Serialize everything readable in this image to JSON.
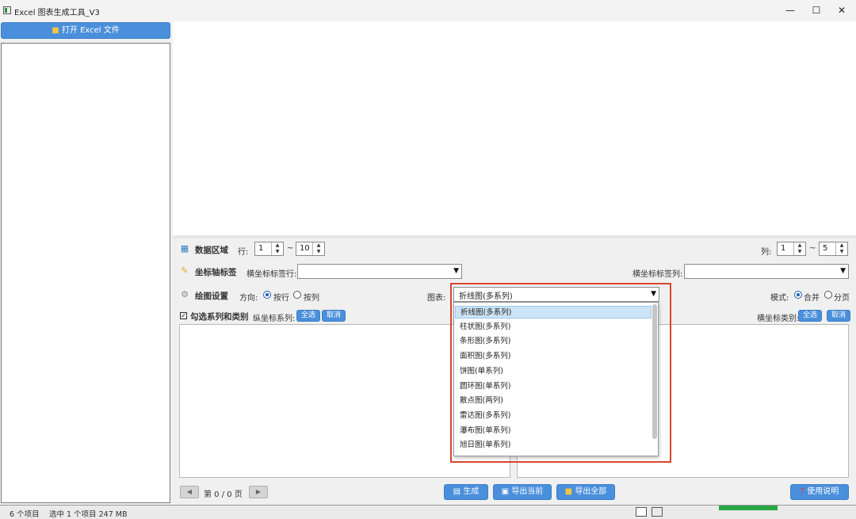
{
  "window": {
    "title": "Excel 图表生成工具_V3"
  },
  "controls": {
    "minimize": "—",
    "maximize": "☐",
    "close": "✕"
  },
  "left": {
    "open_label": "打开 Excel 文件"
  },
  "data_area": {
    "title": "数据区域",
    "row_label": "行:",
    "row_from": "1",
    "row_to": "10",
    "tilde": "~",
    "col_label": "列:",
    "col_from": "1",
    "col_to": "5"
  },
  "axis_labels": {
    "title": "坐标轴标签",
    "x_row_label": "横坐标标签行:",
    "x_row_value": "",
    "x_col_label": "横坐标标签列:",
    "x_col_value": ""
  },
  "plot_settings": {
    "title": "绘图设置",
    "direction_label": "方向:",
    "by_row": "按行",
    "by_col": "按列",
    "chart_label": "图表:",
    "chart_value": "折线图(多系列)",
    "mode_label": "模式:",
    "merge": "合并",
    "split": "分页"
  },
  "series_select": {
    "title": "勾选系列和类别",
    "y_series_label": "纵坐标系列:",
    "select_all": "全选",
    "cancel": "取消",
    "x_category_label": "横坐标类别:"
  },
  "chart_options": [
    "折线图(多系列)",
    "柱状图(多系列)",
    "条形图(多系列)",
    "面积图(多系列)",
    "饼图(单系列)",
    "圆环图(单系列)",
    "散点图(两列)",
    "雷达图(多系列)",
    "瀑布图(单系列)",
    "旭日图(单系列)"
  ],
  "bottom": {
    "prev": "◀",
    "next": "▶",
    "page_text": "第 0 / 0 页",
    "generate": "生成",
    "export_current": "导出当前",
    "export_all": "导出全部",
    "help": "使用说明"
  },
  "taskbar": {
    "items_count": "6 个项目",
    "selected": "选中 1 个项目  247 MB"
  }
}
